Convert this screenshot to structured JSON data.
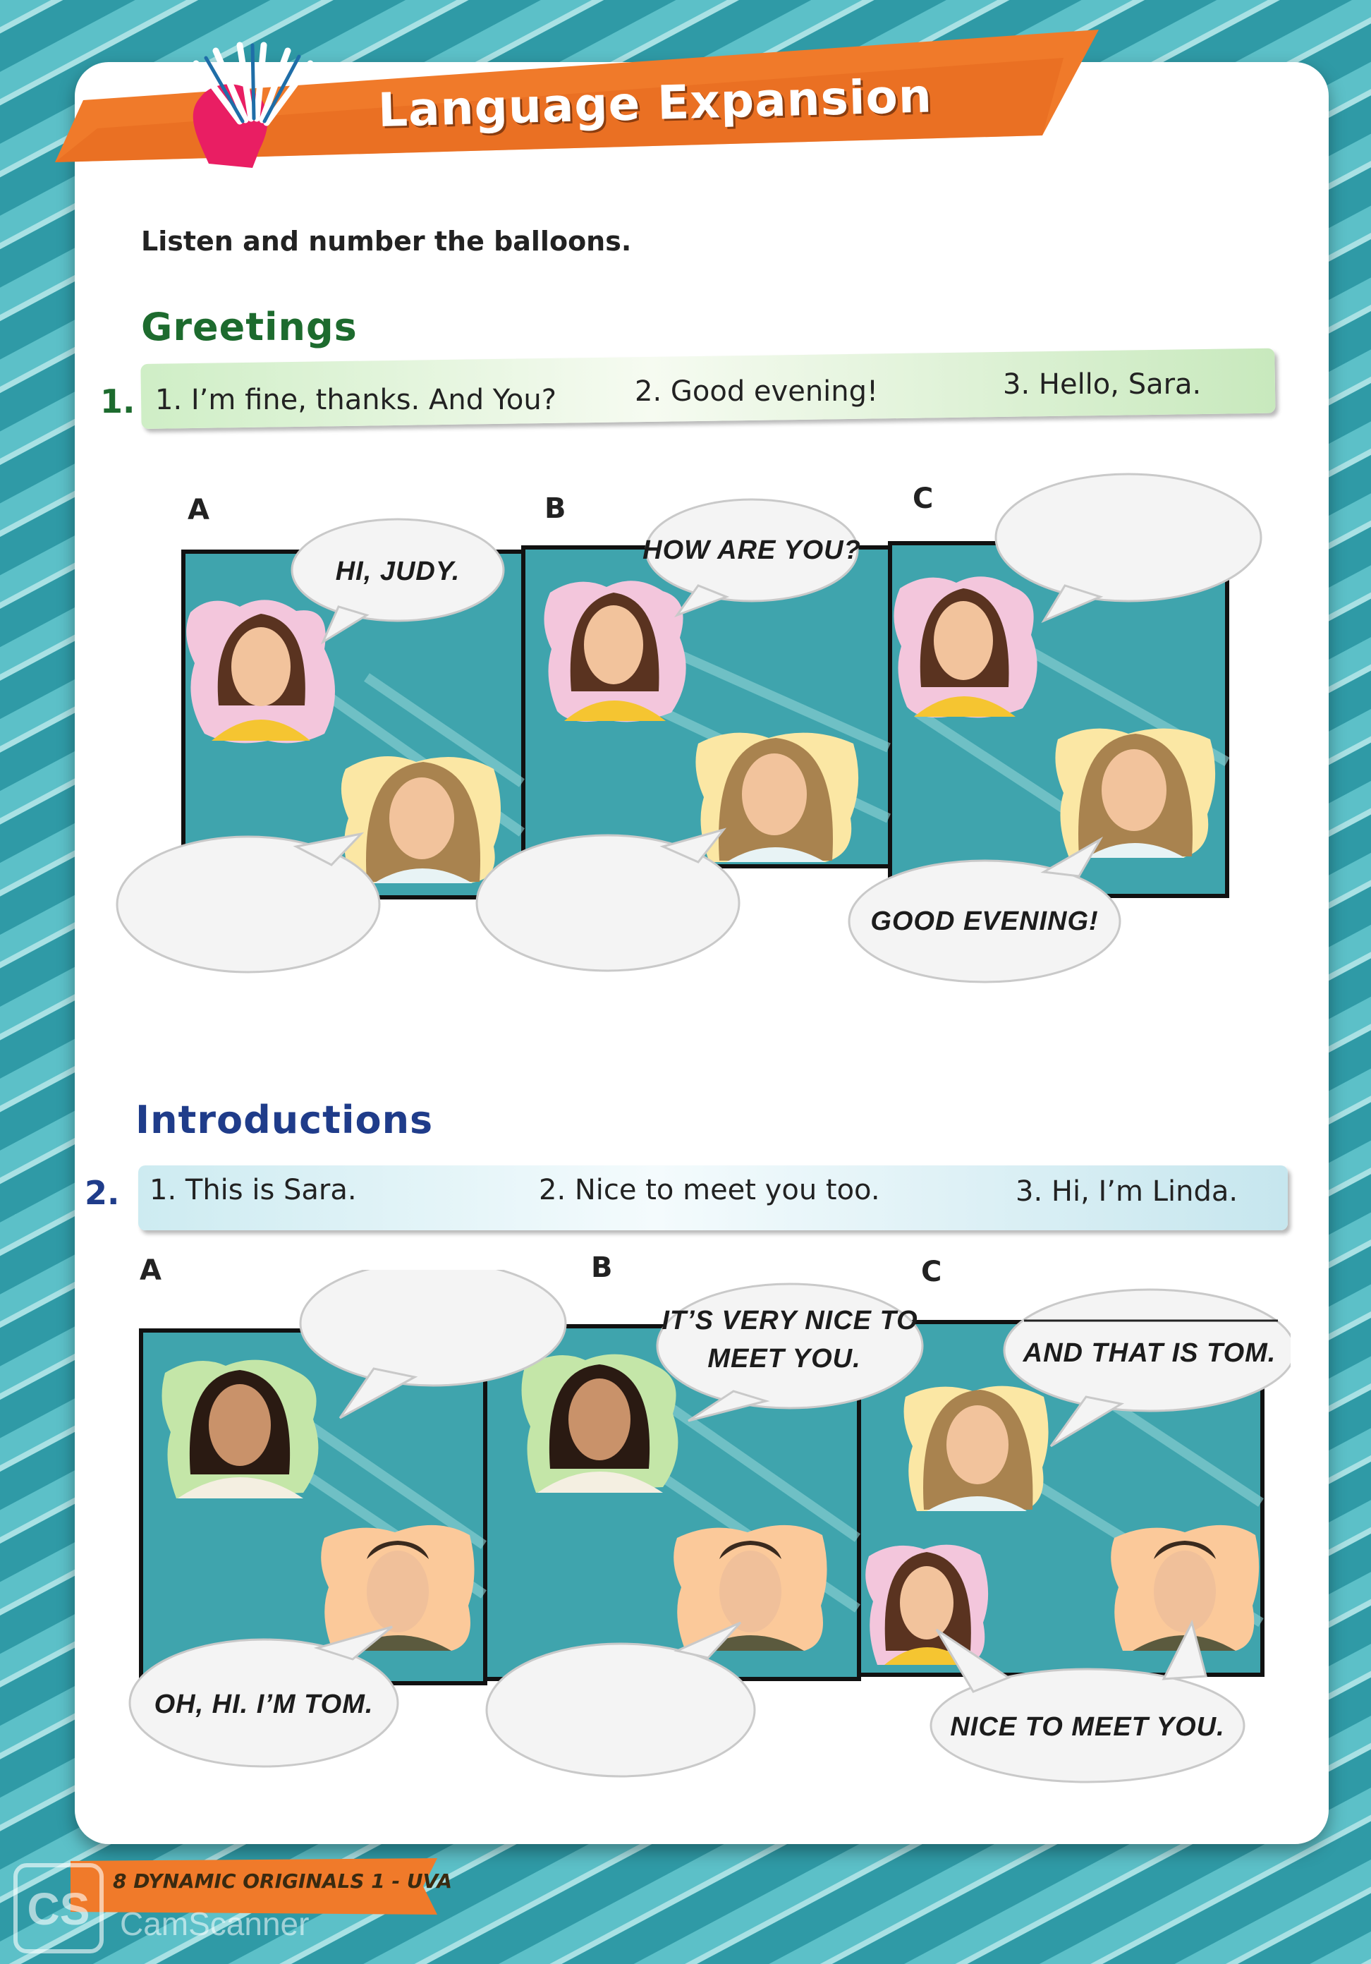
{
  "banner": {
    "title": "Language Expansion"
  },
  "instruction": "Listen and number the balloons.",
  "greetings": {
    "title": "Greetings",
    "number": "1.",
    "options": [
      "1.  I’m fine, thanks. And You?",
      "2. Good evening!",
      "3. Hello, Sara."
    ],
    "panel_letters": [
      "A",
      "B",
      "C"
    ],
    "balloons": {
      "a_top": "HI, JUDY.",
      "b_top": "HOW ARE YOU?",
      "c_bottom": "GOOD EVENING!"
    }
  },
  "introductions": {
    "title": "Introductions",
    "number": "2.",
    "options": [
      "1.  This is Sara.",
      "2. Nice to meet you too.",
      "3. Hi, I’m Linda."
    ],
    "panel_letters": [
      "A",
      "B",
      "C"
    ],
    "balloons": {
      "a_bottom": "OH, HI. I’M TOM.",
      "b_top_line1": "IT’S VERY NICE TO",
      "b_top_line2": "MEET YOU.",
      "c_top": "AND THAT IS TOM.",
      "c_bottom": "NICE TO MEET YOU."
    }
  },
  "footer": {
    "text": "8  DYNAMIC ORIGINALS 1 - UVA"
  },
  "watermark": {
    "badge": "CS",
    "text": "CamScanner"
  },
  "colors": {
    "page_bg": "#2f9aa6",
    "banner": "#f07a2a",
    "greetings": "#1d6b2e",
    "introductions": "#1f3c8a"
  }
}
